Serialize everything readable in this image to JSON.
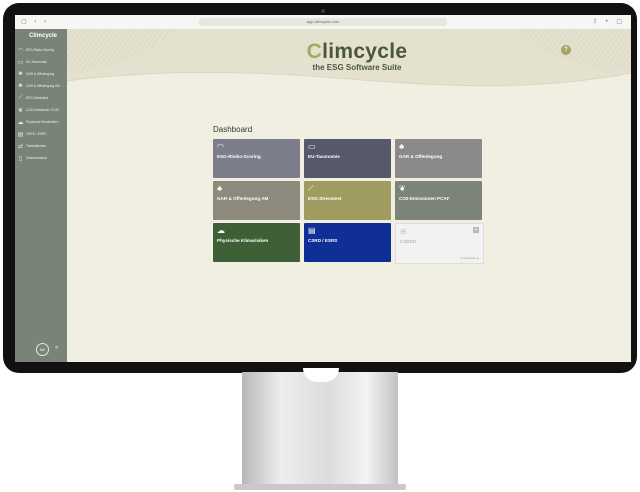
{
  "browser": {
    "url": "app.climcycle.com"
  },
  "sidebar": {
    "brand": "Climcycle",
    "items": [
      {
        "label": "ESG-Risiko-Scoring",
        "icon": "gauge-icon"
      },
      {
        "label": "EU-Taxonomie",
        "icon": "book-icon"
      },
      {
        "label": "GAR & Offenlegung",
        "icon": "plant-icon"
      },
      {
        "label": "GAR & Offenlegung AM",
        "icon": "plant-icon"
      },
      {
        "label": "ESG-Stresstest",
        "icon": "chart-line-icon"
      },
      {
        "label": "CO2-Emissionen PCAF",
        "icon": "footprint-icon"
      },
      {
        "label": "Physische Klimarisiken",
        "icon": "cloud-hazard-icon"
      },
      {
        "label": "CSRD / ESRS",
        "icon": "document-icon"
      },
      {
        "label": "Transaktionen",
        "icon": "transactions-icon"
      },
      {
        "label": "Dokumentation",
        "icon": "file-icon"
      }
    ],
    "avatar_initials": "IW",
    "collapse_glyph": "«"
  },
  "header": {
    "logo_c": "C",
    "logo_rest": "limcycle",
    "subtitle": "the ESG Software Suite",
    "help_glyph": "?"
  },
  "dashboard": {
    "title": "Dashboard",
    "tiles": [
      {
        "label": "ESG-Risiko-Scoring",
        "icon": "gauge-icon",
        "color": "#7c7e8c"
      },
      {
        "label": "EU-Taxonomie",
        "icon": "book-icon",
        "color": "#55596a"
      },
      {
        "label": "GAR & Offenlegung",
        "icon": "plant-icon",
        "color": "#898a89"
      },
      {
        "label": "GAR & Offenlegung AM",
        "icon": "plant-icon",
        "color": "#8b8a7d"
      },
      {
        "label": "ESG-Stresstest",
        "icon": "chart-line-icon",
        "color": "#a09c61"
      },
      {
        "label": "CO2-Emissionen PCAF",
        "icon": "footprint-icon",
        "color": "#7c8377"
      },
      {
        "label": "Physische Klimarisiken",
        "icon": "cloud-hazard-icon",
        "color": "#3f5f37"
      },
      {
        "label": "CSRD / ESRS",
        "icon": "document-icon",
        "color": "#0f2f97"
      },
      {
        "label": "CSDDD",
        "icon": "lock-icon",
        "color": "#f2f2f2",
        "disabled": true,
        "note": "In Vorbereitung"
      }
    ]
  },
  "colors": {
    "sidebar": "#7a8378",
    "page_background": "#f0efe1",
    "accent": "#a5a865",
    "brand_dark": "#4b5640"
  }
}
